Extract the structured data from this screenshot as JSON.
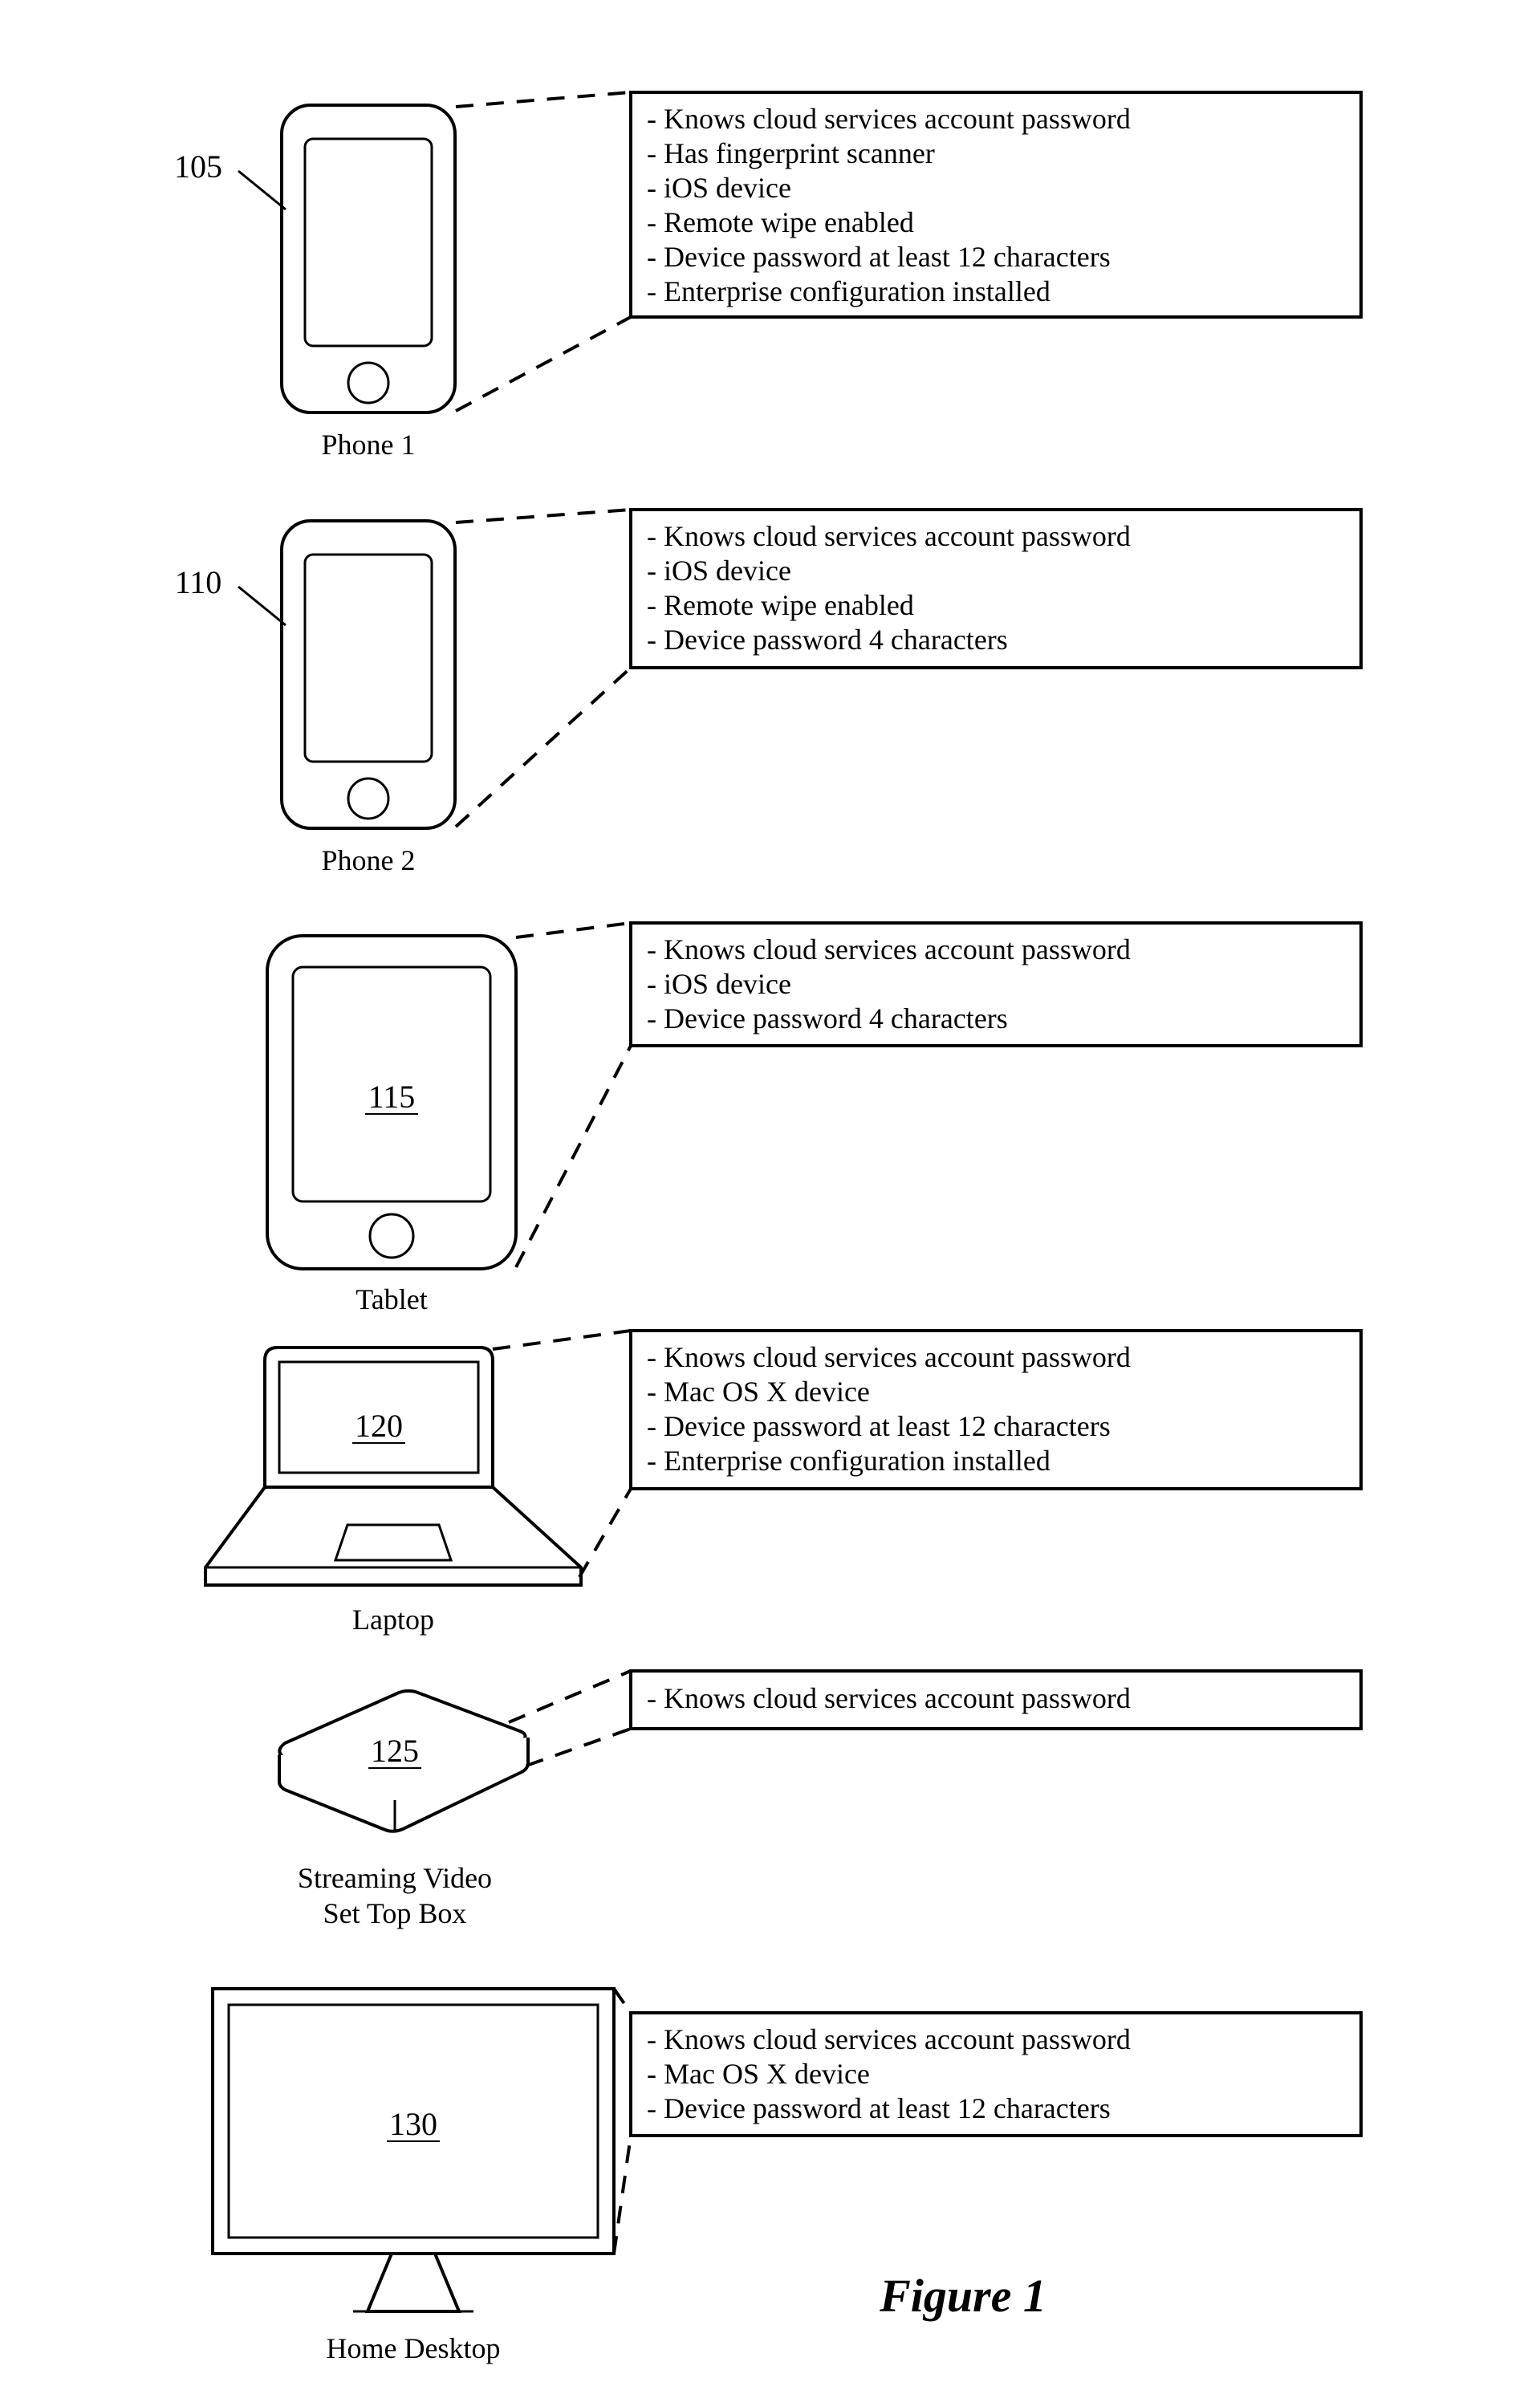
{
  "figure_title": "Figure 1",
  "devices": [
    {
      "key": "phone1",
      "label": "Phone 1",
      "ref": "105",
      "attrs": [
        "- Knows cloud services account password",
        "- Has fingerprint scanner",
        "- iOS device",
        "- Remote wipe enabled",
        "- Device password at least 12 characters",
        "- Enterprise configuration installed"
      ]
    },
    {
      "key": "phone2",
      "label": "Phone 2",
      "ref": "110",
      "attrs": [
        "- Knows cloud services account password",
        "- iOS device",
        "- Remote wipe enabled",
        "- Device password 4 characters"
      ]
    },
    {
      "key": "tablet",
      "label": "Tablet",
      "ref": "115",
      "attrs": [
        "- Knows cloud services account password",
        "- iOS device",
        "- Device password 4 characters"
      ]
    },
    {
      "key": "laptop",
      "label": "Laptop",
      "ref": "120",
      "attrs": [
        "- Knows cloud services account password",
        "- Mac OS X device",
        "- Device password at least 12 characters",
        "- Enterprise configuration installed"
      ]
    },
    {
      "key": "settop",
      "label_line1": "Streaming Video",
      "label_line2": "Set Top Box",
      "ref": "125",
      "attrs": [
        "- Knows cloud services account password"
      ]
    },
    {
      "key": "desktop",
      "label": "Home Desktop",
      "ref": "130",
      "attrs": [
        "- Knows cloud services account password",
        "- Mac OS X device",
        "- Device password at least 12 characters"
      ]
    }
  ]
}
